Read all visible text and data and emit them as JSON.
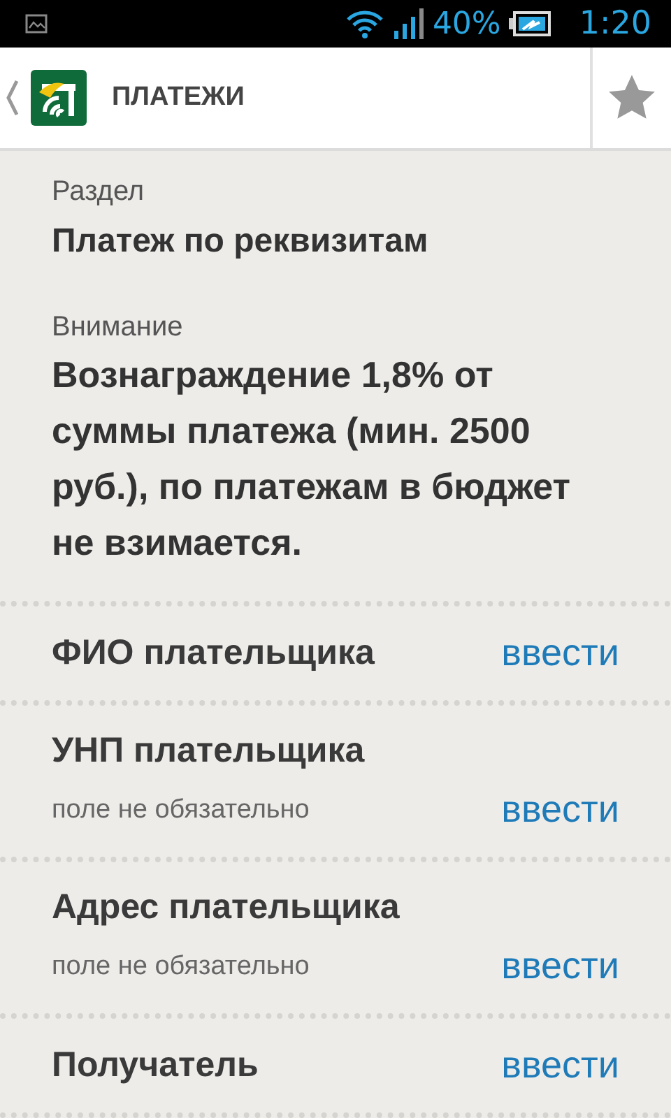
{
  "status_bar": {
    "battery": "40%",
    "time": "1:20"
  },
  "header": {
    "title": "ПЛАТЕЖИ"
  },
  "section": {
    "label": "Раздел",
    "value": "Платеж по реквизитам"
  },
  "notice": {
    "label": "Внимание",
    "text": "Вознаграждение 1,8% от суммы платежа (мин. 2500 руб.), по платежам в бюджет не взимается."
  },
  "fields": [
    {
      "title": "ФИО плательщика",
      "action": "ввести"
    },
    {
      "title": "УНП плательщика",
      "hint": "поле не обязательно",
      "action": "ввести"
    },
    {
      "title": "Адрес плательщика",
      "hint": "поле не обязательно",
      "action": "ввести"
    },
    {
      "title": "Получатель",
      "action": "ввести"
    }
  ]
}
